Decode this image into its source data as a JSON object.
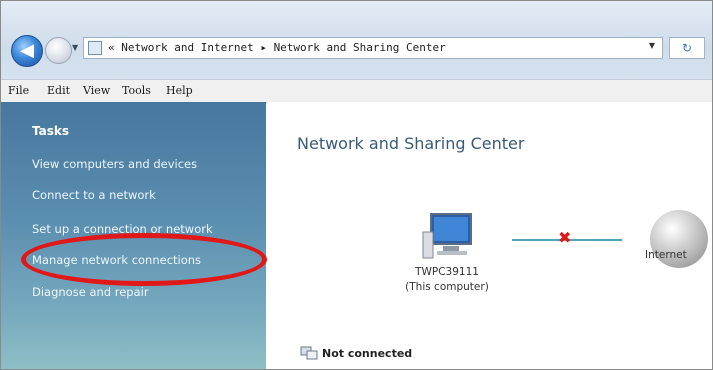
{
  "addressbar": {
    "path": "« Network and Internet ▸ Network and Sharing Center",
    "back_glyph": "◀",
    "refresh_glyph": "↻"
  },
  "menu": {
    "items": [
      "File",
      "Edit",
      "View",
      "Tools",
      "Help"
    ]
  },
  "sidebar": {
    "title": "Tasks",
    "items": [
      "View computers and devices",
      "Connect to a network",
      "Set up a connection or network",
      "Manage network connections",
      "Diagnose and repair"
    ],
    "highlighted_item": "Manage network connections",
    "highlight_color": "#e01818"
  },
  "main": {
    "title": "Network and Sharing Center",
    "computer": {
      "name": "TWPC39111",
      "subtitle": "(This computer)"
    },
    "connection_state_symbol": "✖",
    "internet_label": "Internet",
    "status": "Not connected"
  },
  "icons": [
    "back-arrow-icon",
    "forward-arrow-icon",
    "network-folder-icon",
    "refresh-icon",
    "computer-icon",
    "disconnected-x-icon",
    "globe-icon",
    "network-status-icon"
  ]
}
